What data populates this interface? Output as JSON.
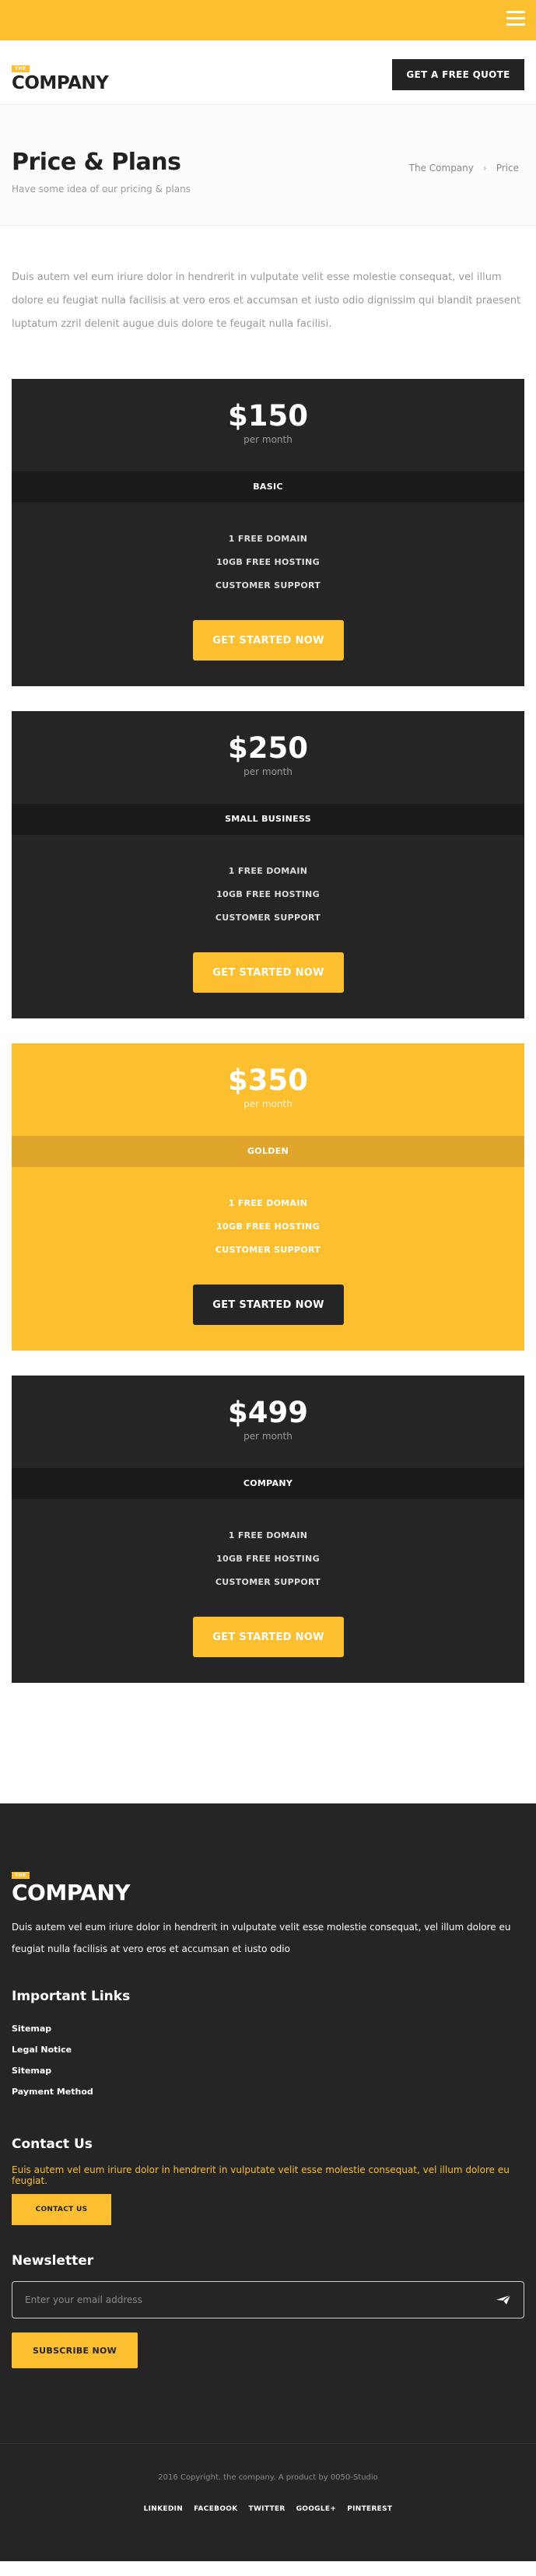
{
  "header": {
    "logo_badge": "THE",
    "logo_text": "COMPANY",
    "quote_button": "GET A FREE QUOTE"
  },
  "page_title": {
    "title": "Price & Plans",
    "subtitle": "Have some idea of our pricing & plans",
    "breadcrumb": [
      "The Company",
      "Price"
    ],
    "breadcrumb_sep": "›"
  },
  "intro": "Duis autem vel eum iriure dolor in hendrerit in vulputate velit esse molestie consequat, vel illum dolore eu feugiat nulla facilisis at vero eros et accumsan et iusto odio dignissim qui blandit praesent luptatum zzril delenit augue duis dolore te feugait nulla facilisi.",
  "plans": [
    {
      "price": "$150",
      "period": "per month",
      "tier": "BASIC",
      "features": [
        "1 FREE DOMAIN",
        "10GB FREE HOSTING",
        "CUSTOMER SUPPORT"
      ],
      "cta": "GET STARTED NOW",
      "featured": false
    },
    {
      "price": "$250",
      "period": "per month",
      "tier": "SMALL BUSINESS",
      "features": [
        "1 FREE DOMAIN",
        "10GB FREE HOSTING",
        "CUSTOMER SUPPORT"
      ],
      "cta": "GET STARTED NOW",
      "featured": false
    },
    {
      "price": "$350",
      "period": "per month",
      "tier": "GOLDEN",
      "features": [
        "1 FREE DOMAIN",
        "10GB FREE HOSTING",
        "CUSTOMER SUPPORT"
      ],
      "cta": "GET STARTED NOW",
      "featured": true
    },
    {
      "price": "$499",
      "period": "per month",
      "tier": "COMPANY",
      "features": [
        "1 FREE DOMAIN",
        "10GB FREE HOSTING",
        "CUSTOMER SUPPORT"
      ],
      "cta": "GET STARTED NOW",
      "featured": false
    }
  ],
  "footer": {
    "logo_badge": "THE",
    "logo_text": "COMPANY",
    "description": "Duis autem vel eum iriure dolor in hendrerit in vulputate velit esse molestie consequat, vel illum dolore eu feugiat nulla facilisis at vero eros et accumsan et iusto odio",
    "links_heading": "Important Links",
    "links": [
      "Sitemap",
      "Legal Notice",
      "Sitemap",
      "Payment Method"
    ],
    "contact_heading": "Contact Us",
    "contact_text": "Euis autem vel eum iriure dolor in hendrerit in vulputate velit esse molestie consequat, vel illum dolore eu feugiat.",
    "contact_button": "CONTACT US",
    "newsletter_heading": "Newsletter",
    "email_placeholder": "Enter your email address",
    "subscribe_button": "SUBSCRIBE NOW",
    "copyright": "2016 Copyright. the company. A product by 0050-Studio",
    "social": [
      "LINKEDIN",
      "FACEBOOK",
      "TWITTER",
      "GOOGLE+",
      "PINTEREST"
    ]
  },
  "colors": {
    "accent": "#fbbf2f",
    "dark": "#252525"
  },
  "icons": {
    "menu": "hamburger-menu-icon",
    "send": "send-icon"
  }
}
